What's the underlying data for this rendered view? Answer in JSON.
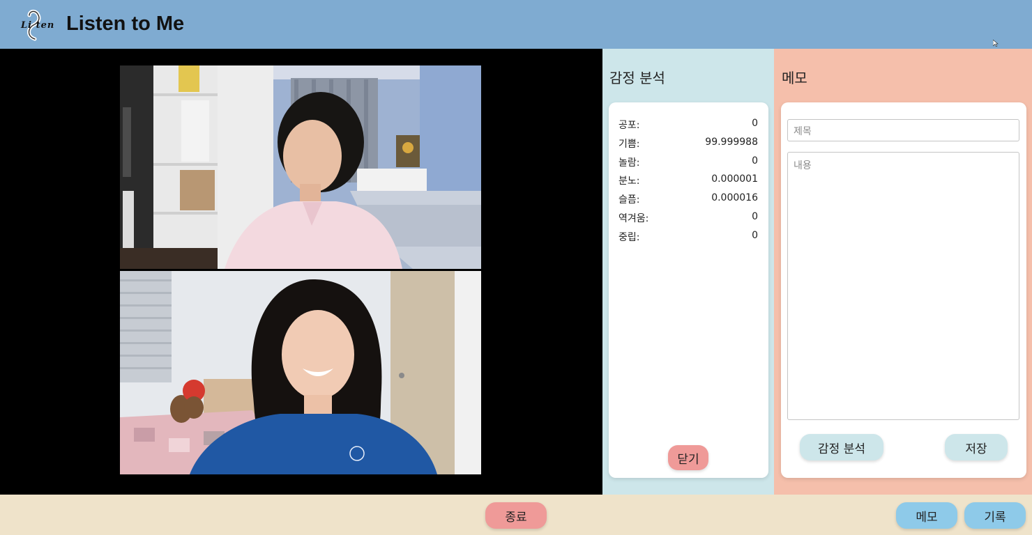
{
  "header": {
    "logo_text": "Li  ten",
    "app_title": "Listen to Me"
  },
  "emotion_panel": {
    "title": "감정 분석",
    "rows": [
      {
        "label": "공포:",
        "value": "0"
      },
      {
        "label": "기쁨:",
        "value": "99.999988"
      },
      {
        "label": "놀람:",
        "value": "0"
      },
      {
        "label": "분노:",
        "value": "0.000001"
      },
      {
        "label": "슬픔:",
        "value": "0.000016"
      },
      {
        "label": "역겨움:",
        "value": "0"
      },
      {
        "label": "중립:",
        "value": "0"
      }
    ],
    "close_label": "닫기"
  },
  "memo_panel": {
    "title": "메모",
    "title_placeholder": "제목",
    "body_placeholder": "내용",
    "analyze_label": "감정 분석",
    "save_label": "저장"
  },
  "footer": {
    "end_label": "종료",
    "memo_label": "메모",
    "record_label": "기록"
  },
  "colors": {
    "header_bg": "#7fabd1",
    "emotion_bg": "#cde6ea",
    "memo_bg": "#f5bfab",
    "footer_bg": "#efe3ca",
    "danger_button": "#ef9a98",
    "primary_button": "#8ecae9"
  }
}
